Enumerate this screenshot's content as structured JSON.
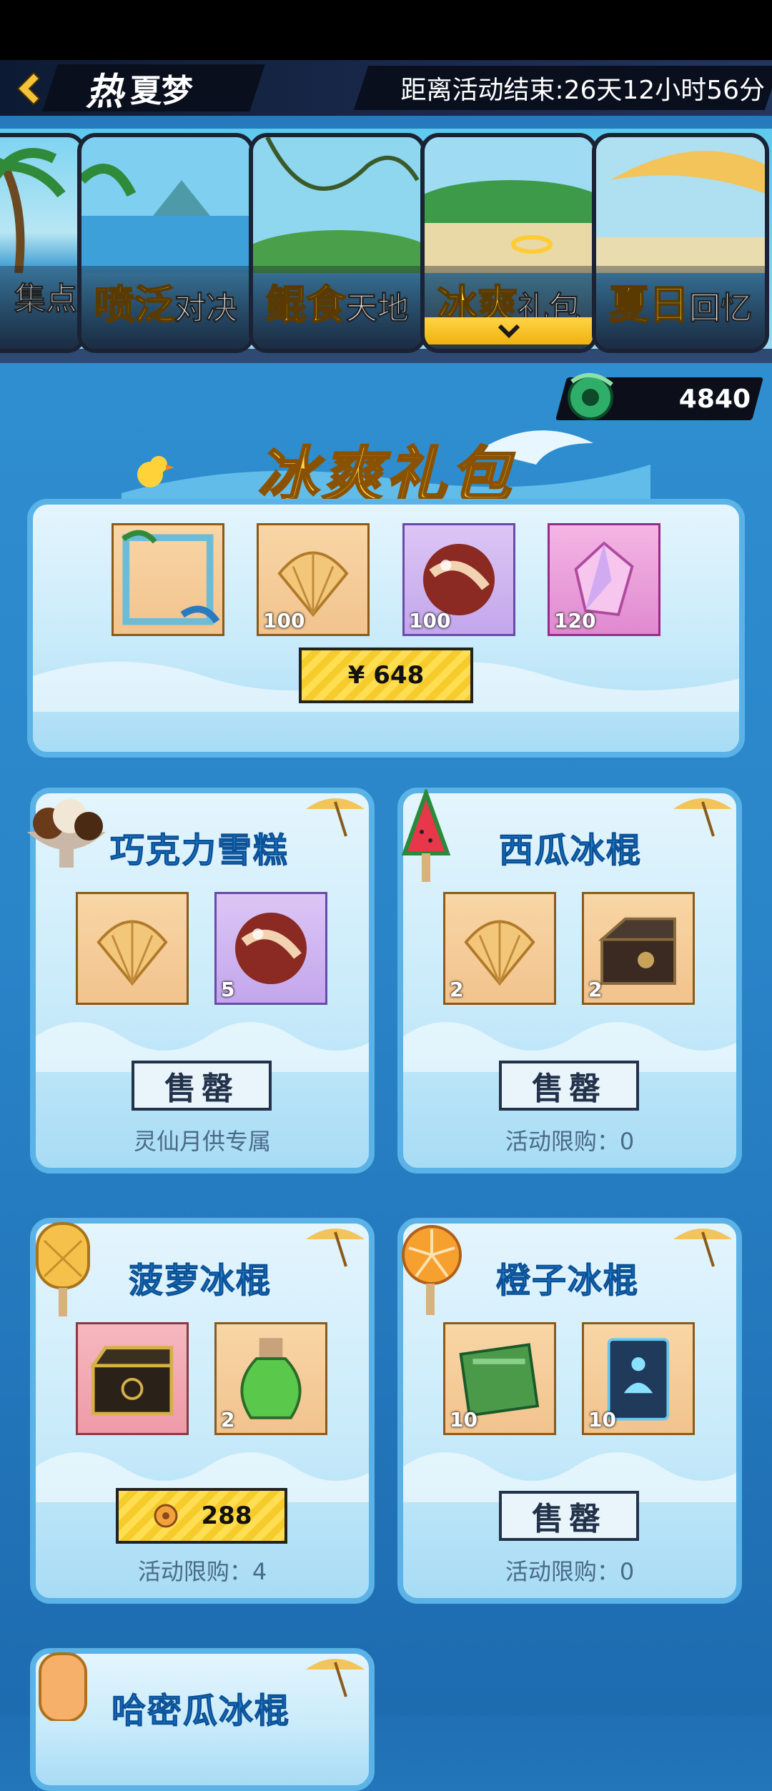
{
  "header": {
    "hot_label": "热",
    "title": "夏梦",
    "timer": "距离活动结束:26天12小时56分"
  },
  "tabs": [
    {
      "big": "",
      "small": "集点",
      "active": false
    },
    {
      "big": "喷泛",
      "small": "对决",
      "active": false
    },
    {
      "big": "鲲食",
      "small": "天地",
      "active": false
    },
    {
      "big": "冰爽",
      "small": "礼包",
      "active": true
    },
    {
      "big": "夏日",
      "small": "回忆",
      "active": false
    }
  ],
  "currency": {
    "icon": "jade-coin-icon",
    "value": "4840"
  },
  "section_title": "冰爽礼包",
  "main_pack": {
    "items": [
      {
        "icon": "avatar-frame-icon",
        "count": ""
      },
      {
        "icon": "shell-icon",
        "count": "100"
      },
      {
        "icon": "marble-orb-icon",
        "count": "100"
      },
      {
        "icon": "crystal-icon",
        "count": "120"
      }
    ],
    "price": "¥  648"
  },
  "packs": [
    {
      "title": "巧克力雪糕",
      "deco_icon": "ice-cream-sundae-icon",
      "items": [
        {
          "icon": "shell-icon",
          "count": ""
        },
        {
          "icon": "marble-orb-icon",
          "count": "5"
        }
      ],
      "button": "售罄",
      "button_type": "sold",
      "note": "灵仙月供专属"
    },
    {
      "title": "西瓜冰棍",
      "deco_icon": "watermelon-popsicle-icon",
      "items": [
        {
          "icon": "shell-icon",
          "count": "2"
        },
        {
          "icon": "treasure-chest-icon",
          "count": "2"
        }
      ],
      "button": "售罄",
      "button_type": "sold",
      "note": "活动限购：0"
    },
    {
      "title": "菠萝冰棍",
      "deco_icon": "pineapple-popsicle-icon",
      "items": [
        {
          "icon": "golden-chest-icon",
          "count": ""
        },
        {
          "icon": "potion-bottle-icon",
          "count": "2"
        }
      ],
      "button": "288",
      "button_type": "price",
      "note": "活动限购：4"
    },
    {
      "title": "橙子冰棍",
      "deco_icon": "orange-popsicle-icon",
      "items": [
        {
          "icon": "green-scroll-icon",
          "count": "10"
        },
        {
          "icon": "meditation-card-icon",
          "count": "10"
        }
      ],
      "button": "售罄",
      "button_type": "sold",
      "note": "活动限购：0"
    },
    {
      "title": "哈密瓜冰棍",
      "deco_icon": "melon-popsicle-icon",
      "items": [],
      "button": "",
      "button_type": "",
      "note": ""
    }
  ]
}
